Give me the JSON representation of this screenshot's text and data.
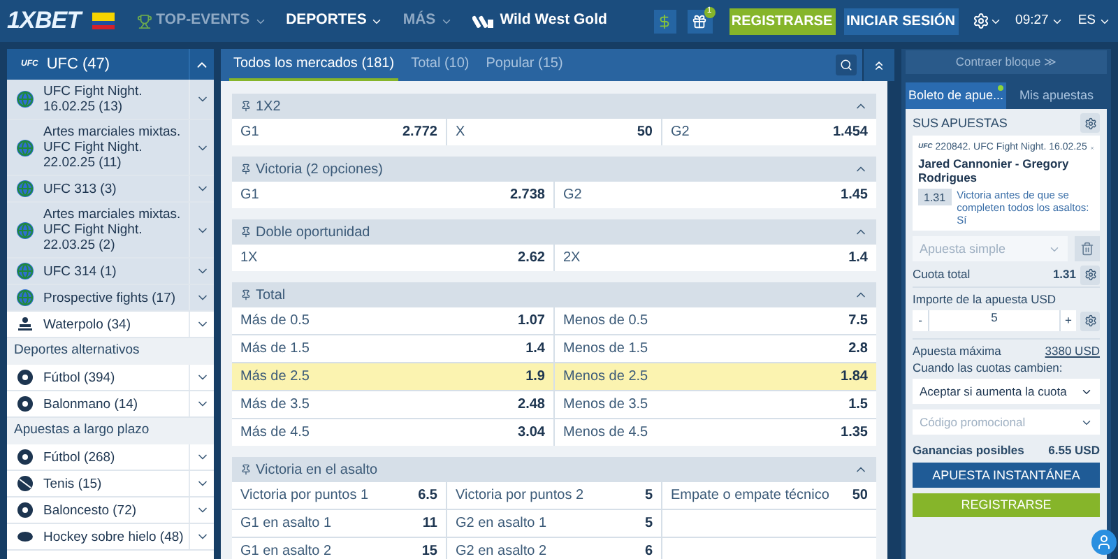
{
  "header": {
    "logo": "1XBET",
    "nav": [
      {
        "label": "TOP-EVENTS",
        "kind": "trophy",
        "selected": false
      },
      {
        "label": "DEPORTES",
        "kind": "plain",
        "selected": true
      },
      {
        "label": "MÁS",
        "kind": "plain",
        "selected": false
      }
    ],
    "promo": "Wild West Gold",
    "gift_badge": "1",
    "register": "REGISTRARSE",
    "login": "INICIAR SESIÓN",
    "time": "09:27",
    "language": "ES"
  },
  "sidebar": {
    "top": {
      "label": "UFC (47)",
      "badge": "UFC",
      "expanded": true
    },
    "items": [
      {
        "kind": "league",
        "label": "UFC Fight Night. 16.02.25 (13)"
      },
      {
        "kind": "league",
        "label": "Artes marciales mixtas. UFC Fight Night. 22.02.25 (11)"
      },
      {
        "kind": "league",
        "label": "UFC 313 (3)"
      },
      {
        "kind": "league",
        "label": "Artes marciales mixtas. UFC Fight Night. 22.03.25 (2)"
      },
      {
        "kind": "league",
        "label": "UFC 314 (1)"
      },
      {
        "kind": "league",
        "label": "Prospective fights (17)"
      },
      {
        "kind": "swimmer",
        "label": "Waterpolo (34)"
      },
      {
        "kind": "heading",
        "label": "Deportes alternativos"
      },
      {
        "kind": "ball",
        "label": "Fútbol (394)"
      },
      {
        "kind": "ball",
        "label": "Balonmano (14)"
      },
      {
        "kind": "heading",
        "label": "Apuestas a largo plazo"
      },
      {
        "kind": "ball",
        "label": "Fútbol (268)"
      },
      {
        "kind": "tennis",
        "label": "Tenis (15)"
      },
      {
        "kind": "ball",
        "label": "Baloncesto (72)"
      },
      {
        "kind": "puck",
        "label": "Hockey sobre hielo (48)"
      }
    ]
  },
  "tabs": [
    {
      "label": "Todos los mercados (181)",
      "selected": true
    },
    {
      "label": "Total (10)",
      "selected": false
    },
    {
      "label": "Popular (15)",
      "selected": false
    }
  ],
  "markets": [
    {
      "title": "1X2",
      "rows": [
        [
          {
            "label": "G1",
            "odd": "2.772",
            "selected": false
          },
          {
            "label": "X",
            "odd": "50",
            "selected": false
          },
          {
            "label": "G2",
            "odd": "1.454",
            "selected": false
          }
        ]
      ]
    },
    {
      "title": "Victoria (2 opciones)",
      "rows": [
        [
          {
            "label": "G1",
            "odd": "2.738",
            "selected": false
          },
          {
            "label": "G2",
            "odd": "1.45",
            "selected": false
          }
        ]
      ]
    },
    {
      "title": "Doble oportunidad",
      "rows": [
        [
          {
            "label": "1X",
            "odd": "2.62",
            "selected": false
          },
          {
            "label": "2X",
            "odd": "1.4",
            "selected": false
          }
        ]
      ]
    },
    {
      "title": "Total",
      "rows": [
        [
          {
            "label": "Más de 0.5",
            "odd": "1.07",
            "selected": false
          },
          {
            "label": "Menos de 0.5",
            "odd": "7.5",
            "selected": false
          }
        ],
        [
          {
            "label": "Más de 1.5",
            "odd": "1.4",
            "selected": false
          },
          {
            "label": "Menos de 1.5",
            "odd": "2.8",
            "selected": false
          }
        ],
        [
          {
            "label": "Más de 2.5",
            "odd": "1.9",
            "selected": true
          },
          {
            "label": "Menos de 2.5",
            "odd": "1.84",
            "selected": true
          }
        ],
        [
          {
            "label": "Más de 3.5",
            "odd": "2.48",
            "selected": false
          },
          {
            "label": "Menos de 3.5",
            "odd": "1.5",
            "selected": false
          }
        ],
        [
          {
            "label": "Más de 4.5",
            "odd": "3.04",
            "selected": false
          },
          {
            "label": "Menos de 4.5",
            "odd": "1.35",
            "selected": false
          }
        ]
      ]
    },
    {
      "title": "Victoria en el asalto",
      "rows": [
        [
          {
            "label": "Victoria por puntos 1",
            "odd": "6.5",
            "selected": false
          },
          {
            "label": "Victoria por puntos 2",
            "odd": "5",
            "selected": false
          },
          {
            "label": "Empate o empate técnico",
            "odd": "50",
            "selected": false
          }
        ],
        [
          {
            "label": "G1 en asalto 1",
            "odd": "11",
            "selected": false
          },
          {
            "label": "G2 en asalto 1",
            "odd": "5",
            "selected": false
          }
        ],
        [
          {
            "label": "G1 en asalto 2",
            "odd": "15",
            "selected": false
          },
          {
            "label": "G2 en asalto 2",
            "odd": "6",
            "selected": false
          }
        ]
      ]
    }
  ],
  "betslip": {
    "collapse": "Contraer bloque ≫",
    "tabs": [
      {
        "label": "Boleto de apue...",
        "selected": true,
        "dot": true
      },
      {
        "label": "Mis apuestas",
        "selected": false,
        "dot": false
      }
    ],
    "heading": "SUS APUESTAS",
    "bet": {
      "badge": "UFC",
      "event": "220842. UFC Fight Night. 16.02.25",
      "teams": "Jared Cannonier - Gregory Rodrigues",
      "odd": "1.31",
      "pick": "Victoria antes de que se completen todos los asaltos: Sí"
    },
    "bet_type": {
      "placeholder": "Apuesta simple"
    },
    "total_label": "Cuota total",
    "total": "1.31",
    "amount_label": "Importe de la apuesta USD",
    "minus": "-",
    "amount": "5",
    "plus": "+",
    "max_label": "Apuesta máxima",
    "max": "3380 USD",
    "odds_change_label": "Cuando las cuotas cambien:",
    "odds_change": "Aceptar si aumenta la cuota",
    "promo_code": {
      "placeholder": "Código promocional"
    },
    "winnings_label": "Ganancias posibles",
    "winnings": "6.55 USD",
    "instant": "APUESTA INSTANTÁNEA",
    "register": "REGISTRARSE"
  }
}
